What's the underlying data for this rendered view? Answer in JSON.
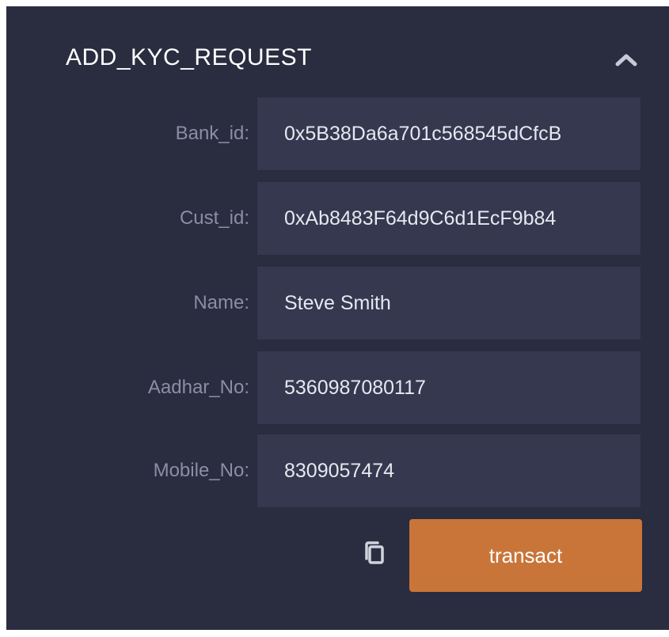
{
  "function": {
    "title": "ADD_KYC_REQUEST",
    "collapse_icon": "chevron-up-icon"
  },
  "fields": [
    {
      "label": "Bank_id:",
      "value": "0x5B38Da6a701c568545dCfcB"
    },
    {
      "label": "Cust_id:",
      "value": "0xAb8483F64d9C6d1EcF9b84"
    },
    {
      "label": "Name:",
      "value": "Steve Smith"
    },
    {
      "label": "Aadhar_No:",
      "value": "5360987080117"
    },
    {
      "label": "Mobile_No:",
      "value": "8309057474"
    }
  ],
  "actions": {
    "copy_icon": "copy-icon",
    "transact_label": "transact"
  },
  "colors": {
    "panel_bg": "#2a2c3f",
    "field_bg": "#35384f",
    "label_text": "#8a8fa6",
    "button_bg": "#c97539"
  }
}
